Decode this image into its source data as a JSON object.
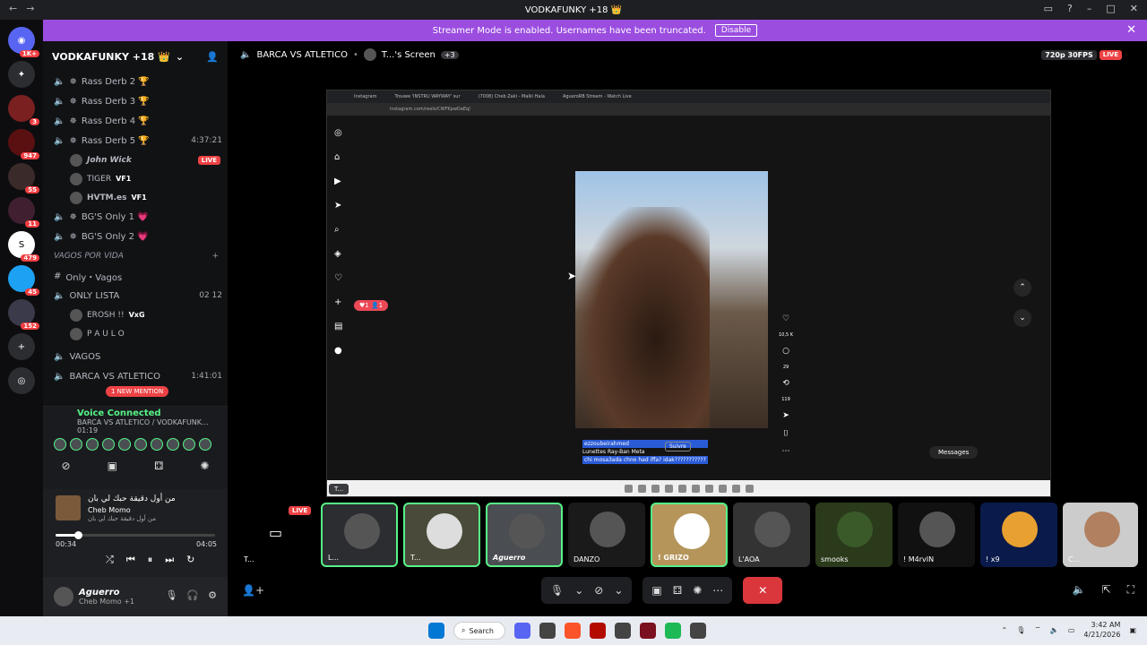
{
  "titlebar": {
    "title": "VODKAFUNKY +18 👑"
  },
  "banner": {
    "text": "Streamer Mode is enabled. Usernames have been truncated.",
    "button": "Disable"
  },
  "servers": [
    {
      "badge": "1K+"
    },
    {
      "badge": "3"
    },
    {
      "badge": "947"
    },
    {
      "badge": "55"
    },
    {
      "badge": "11"
    },
    {
      "badge": "479"
    },
    {
      "badge": "45"
    },
    {
      "badge": "152"
    }
  ],
  "guild": {
    "name": "VODKAFUNKY +18 👑"
  },
  "channels": {
    "rd2": "Rass Derb 2 🏆",
    "rd3": "Rass Derb 3 🏆",
    "rd4": "Rass Derb 4 🏆",
    "rd5": "Rass Derb 5 🏆",
    "rd5_time": "4:37:21",
    "u1": "John Wick",
    "u1_live": "LIVE",
    "u2": "TIGER",
    "u2_tag": "VF1",
    "u3": "HVTM.es",
    "u3_tag": "VF1",
    "bg1": "BG'S Only 1 💗",
    "bg2": "BG'S Only 2 💗",
    "cat": "VAGOS POR VIDA",
    "only": "Only・Vagos",
    "lista": "ONLY LISTA",
    "lista_n1": "02",
    "lista_n2": "12",
    "u4": "EROSH !!",
    "u4_tag": "VxG",
    "u5": "P A U L O",
    "vagos": "VAGOS",
    "barca": "BARCA VS ATLETICO",
    "barca_time": "1:41:01",
    "mention": "1 NEW MENTION"
  },
  "voice": {
    "title": "Voice Connected",
    "channel": "BARCA VS ATLETICO / VODKAFUNK...",
    "time": "01:19"
  },
  "music": {
    "title": "من أول دقيقة حبك لي بان",
    "artist": "Cheb Momo",
    "sub": "من أول دقيقة حبك لي بان",
    "elapsed": "00:34",
    "total": "04:05",
    "progress": 0.14
  },
  "user": {
    "name": "Aguerro",
    "status": "Cheb Momo +1"
  },
  "stage": {
    "server": "BARCA VS ATLETICO",
    "screen": "T...'s Screen",
    "extra": "+3",
    "quality": "720p 30FPS",
    "live": "LIVE"
  },
  "browser": {
    "tabs": [
      "Instagram",
      "Trouwe 'INSTRU WAYWAY' sur",
      "(7008) Cheb Zaki - Malki Hala",
      "AgueroRB Stream - Watch Live"
    ],
    "url": "instagram.com/reels/CWFKpwDaEq/"
  },
  "ig": {
    "notif": "♥1 👤1",
    "user": "ezzoubeirahmed",
    "sub": "Lunettes Ray-Ban Meta",
    "follow": "Suivre",
    "caption": "chi mosa3ada chno had iffa? idak???????????",
    "likes": "10,5 K",
    "comments": "29",
    "shares": "119",
    "messages": "Messages"
  },
  "win": {
    "search": "Search",
    "time": "3:42 AM",
    "date": "4/21/2026"
  },
  "tiles": [
    {
      "name": "T...",
      "live": "LIVE"
    },
    {
      "name": "L..."
    },
    {
      "name": "T..."
    },
    {
      "name": "Aguerro"
    },
    {
      "name": "DANZO"
    },
    {
      "name": "! GRIZO"
    },
    {
      "name": "L'AOA"
    },
    {
      "name": "smooks"
    },
    {
      "name": "! M4rvIN"
    },
    {
      "name": "! x9"
    },
    {
      "name": "C..."
    }
  ],
  "stream_tag": "T..."
}
